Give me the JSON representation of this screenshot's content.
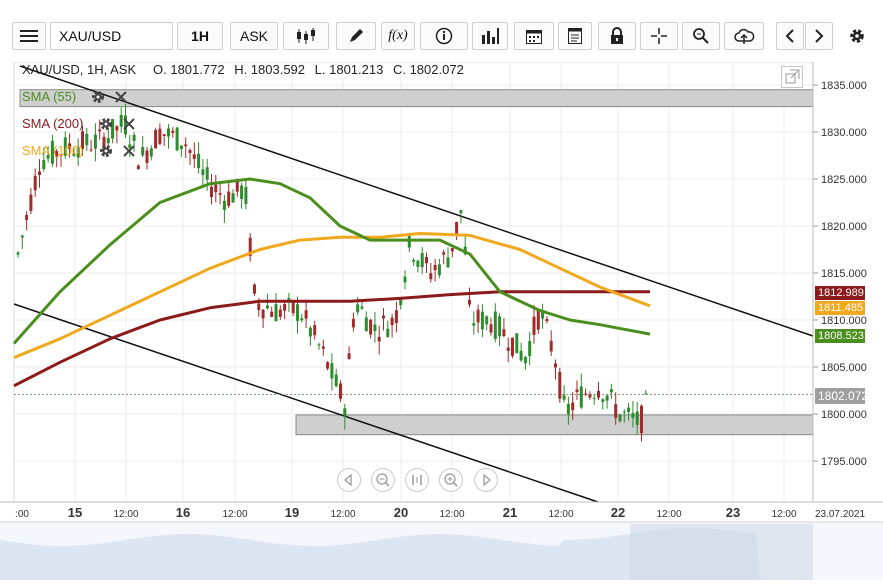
{
  "toolbar": {
    "symbol": "XAU/USD",
    "interval": "1H",
    "price_type": "ASK",
    "function_label": "f(x)"
  },
  "chart": {
    "header": {
      "symbol": "XAU/USD, 1H, ASK",
      "open": "O. 1801.772",
      "high": "H. 1803.592",
      "low": "L. 1801.213",
      "close": "C. 1802.072"
    },
    "legend": [
      {
        "label": "SMA (55)",
        "color": "#4a8f1e"
      },
      {
        "label": "SMA (200)",
        "color": "#8b1a1a"
      },
      {
        "label": "SMA (100)",
        "color": "#f0a81c"
      }
    ],
    "y_ticks": [
      "1835.000",
      "1830.000",
      "1825.000",
      "1820.000",
      "1815.000",
      "1810.000",
      "1805.000",
      "1800.000",
      "1795.000"
    ],
    "x_ticks": [
      ":00",
      "15",
      "12:00",
      "16",
      "12:00",
      "19",
      "12:00",
      "20",
      "12:00",
      "21",
      "12:00",
      "22",
      "12:00",
      "23",
      "12:00",
      "23.07.2021"
    ],
    "price_tags": [
      {
        "label": "1812.989",
        "color": "#8b1a1a"
      },
      {
        "label": "1811.485",
        "color": "#f0a81c"
      },
      {
        "label": "1808.523",
        "color": "#4a8f1e"
      },
      {
        "label": "1802.072",
        "color": "#9e9e9e"
      }
    ]
  },
  "colors": {
    "up": "#2e8b2e",
    "down": "#a32a2a",
    "sma55": "#4a8f1e",
    "sma100": "#f0a81c",
    "sma200": "#8b1a1a"
  }
}
